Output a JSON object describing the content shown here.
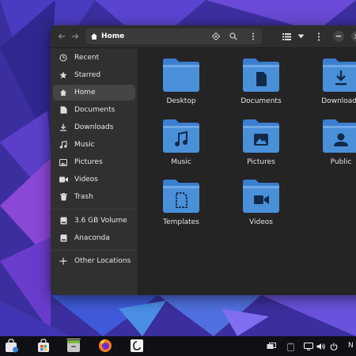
{
  "window": {
    "title": "Home"
  },
  "header": {
    "path_label": "Home",
    "icons": [
      "back-arrow-icon",
      "forward-arrow-icon",
      "home-icon",
      "kebab-menu-icon",
      "location-icon",
      "search-icon",
      "list-view-icon",
      "chevron-down-icon",
      "main-menu-icon",
      "minimize-icon",
      "close-icon"
    ]
  },
  "sidebar": {
    "items": [
      {
        "label": "Recent",
        "icon": "clock-icon"
      },
      {
        "label": "Starred",
        "icon": "star-icon"
      },
      {
        "label": "Home",
        "icon": "home-icon",
        "active": true
      },
      {
        "label": "Documents",
        "icon": "document-icon"
      },
      {
        "label": "Downloads",
        "icon": "download-icon"
      },
      {
        "label": "Music",
        "icon": "music-note-icon"
      },
      {
        "label": "Pictures",
        "icon": "picture-icon"
      },
      {
        "label": "Videos",
        "icon": "video-icon"
      },
      {
        "label": "Trash",
        "icon": "trash-icon"
      },
      {
        "label": "3.6 GB Volume",
        "icon": "drive-icon"
      },
      {
        "label": "Anaconda",
        "icon": "drive-icon"
      },
      {
        "label": "Other Locations",
        "icon": "plus-icon"
      }
    ]
  },
  "folders": [
    {
      "label": "Desktop",
      "icon": "desktop-folder-icon"
    },
    {
      "label": "Documents",
      "icon": "documents-folder-icon"
    },
    {
      "label": "Downloads",
      "icon": "downloads-folder-icon"
    },
    {
      "label": "Music",
      "icon": "music-folder-icon"
    },
    {
      "label": "Pictures",
      "icon": "pictures-folder-icon"
    },
    {
      "label": "Public",
      "icon": "public-folder-icon"
    },
    {
      "label": "Templates",
      "icon": "templates-folder-icon"
    },
    {
      "label": "Videos",
      "icon": "videos-folder-icon"
    }
  ],
  "taskbar": {
    "apps": [
      "software-store-icon",
      "store-bag-icon",
      "files-app-icon",
      "firefox-icon",
      "anaconda-icon"
    ],
    "tray": [
      "display-icon",
      "clipboard-icon",
      "screen-icon",
      "volume-icon",
      "power-icon"
    ],
    "clock_fragment": "N"
  },
  "colors": {
    "folder_blue": "#4a90d9",
    "folder_tab": "#6fa8e6",
    "window_bg": "#242424",
    "sidebar_bg": "#303030",
    "header_bg": "#2e2e2e",
    "wallpaper": "#3a2f9e",
    "taskbar": "#0f0f16"
  }
}
